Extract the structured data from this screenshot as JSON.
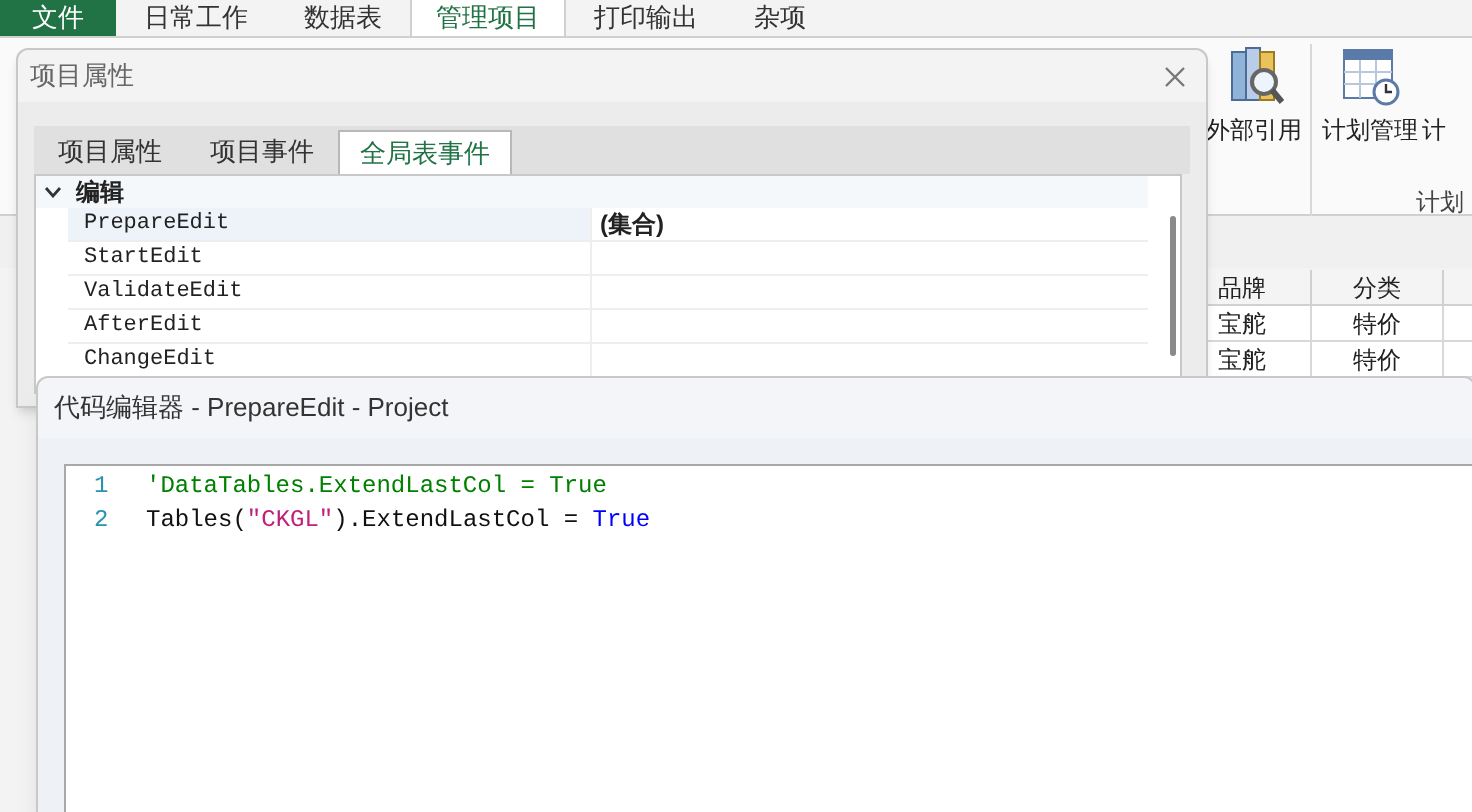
{
  "ribbon": {
    "tabs": [
      {
        "label": "文件",
        "kind": "file",
        "selected": false
      },
      {
        "label": "日常工作",
        "kind": "tab",
        "selected": false
      },
      {
        "label": "数据表",
        "kind": "tab",
        "selected": false
      },
      {
        "label": "管理项目",
        "kind": "tab",
        "selected": true
      },
      {
        "label": "打印输出",
        "kind": "tab",
        "selected": false
      },
      {
        "label": "杂项",
        "kind": "tab",
        "selected": false
      }
    ],
    "buttons": [
      {
        "label": "外部引用",
        "kind": "books"
      },
      {
        "label": "计划管理",
        "kind": "calendar"
      },
      {
        "label": "计",
        "kind": "cut"
      }
    ],
    "group_label": "计划"
  },
  "table": {
    "columns": [
      "品牌",
      "分类"
    ],
    "rows": [
      [
        "宝舵",
        "特价"
      ],
      [
        "宝舵",
        "特价"
      ]
    ]
  },
  "properties_dialog": {
    "title": "项目属性",
    "tabs": [
      {
        "label": "项目属性",
        "selected": false
      },
      {
        "label": "项目事件",
        "selected": false
      },
      {
        "label": "全局表事件",
        "selected": true
      }
    ],
    "category": {
      "label": "编辑",
      "expanded": true,
      "rows": [
        {
          "name": "PrepareEdit",
          "value": "(集合)",
          "selected": true
        },
        {
          "name": "StartEdit",
          "selected": false
        },
        {
          "name": "ValidateEdit",
          "selected": false
        },
        {
          "name": "AfterEdit",
          "selected": false
        },
        {
          "name": "ChangeEdit",
          "selected": false
        }
      ]
    }
  },
  "code_editor": {
    "title": "代码编辑器 - PrepareEdit - Project",
    "lines": [
      {
        "number": "1",
        "tokens": [
          {
            "kind": "comment",
            "text": "'DataTables.ExtendLastCol = True"
          }
        ]
      },
      {
        "number": "2",
        "tokens": [
          {
            "kind": "plain",
            "text": "Tables("
          },
          {
            "kind": "string",
            "text": "\"CKGL\""
          },
          {
            "kind": "plain",
            "text": ").ExtendLastCol = "
          },
          {
            "kind": "keyword",
            "text": "True"
          }
        ]
      }
    ]
  }
}
